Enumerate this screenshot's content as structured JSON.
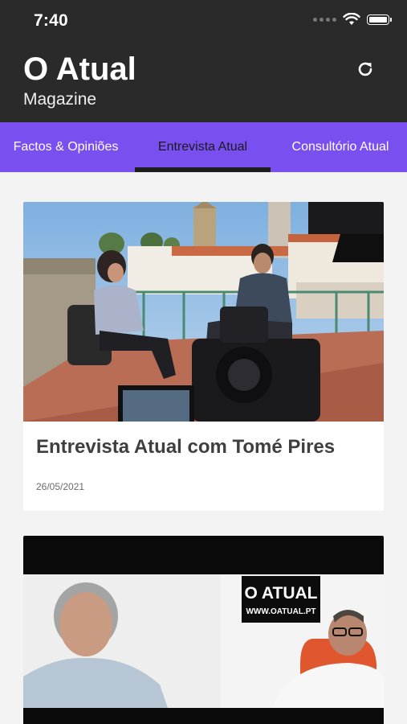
{
  "status_bar": {
    "time": "7:40",
    "icons": [
      "cellular-signal-icon",
      "wifi-icon",
      "battery-icon"
    ]
  },
  "header": {
    "title": "O Atual",
    "subtitle": "Magazine",
    "refresh_icon": "refresh-icon",
    "background": "#2b2a2b"
  },
  "tabs": {
    "items": [
      {
        "label": "Factos & Opiniões"
      },
      {
        "label": "Entrevista Atual"
      },
      {
        "label": "Consultório Atual"
      }
    ],
    "active": "Entrevista Atual",
    "background": "#7a4ff0"
  },
  "articles": [
    {
      "image": "interview-photo-terrace",
      "title": "Entrevista Atual com Tomé Pires",
      "date": "26/05/2021"
    },
    {
      "image": "video-call-interview",
      "logo_text": "O ATUAL",
      "logo_url_text": "WWW.OATUAL.PT"
    }
  ]
}
